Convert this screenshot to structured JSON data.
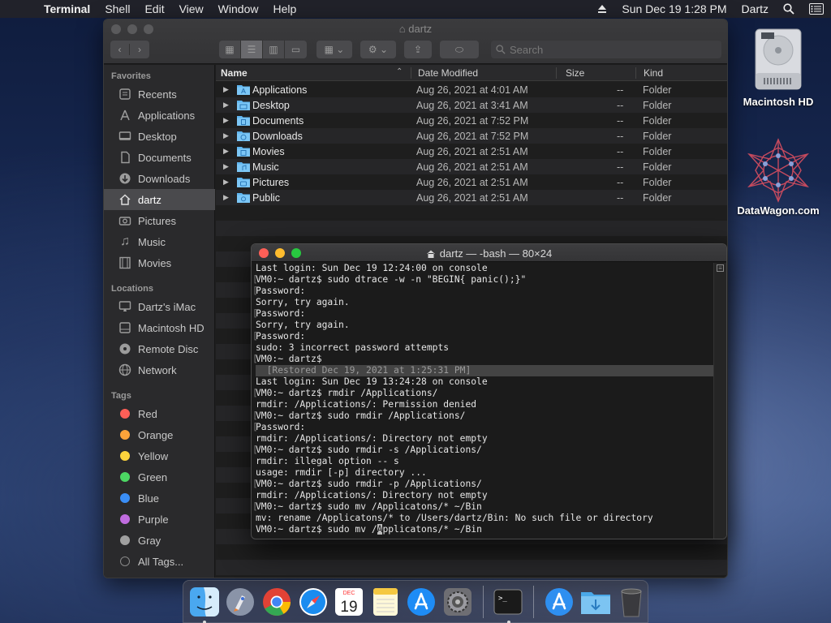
{
  "menubar": {
    "app_name": "Terminal",
    "menus": [
      "Shell",
      "Edit",
      "View",
      "Window",
      "Help"
    ],
    "datetime": "Sun Dec 19  1:28 PM",
    "user": "Dartz"
  },
  "finder": {
    "title": "dartz",
    "search_placeholder": "Search",
    "sidebar": {
      "favorites_label": "Favorites",
      "favorites": [
        "Recents",
        "Applications",
        "Desktop",
        "Documents",
        "Downloads",
        "dartz",
        "Pictures",
        "Music",
        "Movies"
      ],
      "locations_label": "Locations",
      "locations": [
        "Dartz's iMac",
        "Macintosh HD",
        "Remote Disc",
        "Network"
      ],
      "tags_label": "Tags",
      "tags": [
        {
          "label": "Red",
          "color": "#fe5f57"
        },
        {
          "label": "Orange",
          "color": "#fda33a"
        },
        {
          "label": "Yellow",
          "color": "#fdd33d"
        },
        {
          "label": "Green",
          "color": "#4cd763"
        },
        {
          "label": "Blue",
          "color": "#3a8ef6"
        },
        {
          "label": "Purple",
          "color": "#c06cdf"
        },
        {
          "label": "Gray",
          "color": "#a0a0a0"
        },
        {
          "label": "All Tags...",
          "color": ""
        }
      ]
    },
    "columns": {
      "name": "Name",
      "date": "Date Modified",
      "size": "Size",
      "kind": "Kind"
    },
    "files": [
      {
        "name": "Applications",
        "date": "Aug 26, 2021 at 4:01 AM",
        "size": "--",
        "kind": "Folder"
      },
      {
        "name": "Desktop",
        "date": "Aug 26, 2021 at 3:41 AM",
        "size": "--",
        "kind": "Folder"
      },
      {
        "name": "Documents",
        "date": "Aug 26, 2021 at 7:52 PM",
        "size": "--",
        "kind": "Folder"
      },
      {
        "name": "Downloads",
        "date": "Aug 26, 2021 at 7:52 PM",
        "size": "--",
        "kind": "Folder"
      },
      {
        "name": "Movies",
        "date": "Aug 26, 2021 at 2:51 AM",
        "size": "--",
        "kind": "Folder"
      },
      {
        "name": "Music",
        "date": "Aug 26, 2021 at 2:51 AM",
        "size": "--",
        "kind": "Folder"
      },
      {
        "name": "Pictures",
        "date": "Aug 26, 2021 at 2:51 AM",
        "size": "--",
        "kind": "Folder"
      },
      {
        "name": "Public",
        "date": "Aug 26, 2021 at 2:51 AM",
        "size": "--",
        "kind": "Folder"
      }
    ]
  },
  "terminal": {
    "title": "dartz — -bash — 80×24",
    "lines": [
      {
        "text": "Last login: Sun Dec 19 12:24:00 on console",
        "mark": false
      },
      {
        "text": "VM0:~ dartz$ sudo dtrace -w -n \"BEGIN{ panic();}\"",
        "mark": true
      },
      {
        "text": "Password:",
        "mark": true
      },
      {
        "text": "Sorry, try again.",
        "mark": false
      },
      {
        "text": "Password:",
        "mark": true
      },
      {
        "text": "Sorry, try again.",
        "mark": false
      },
      {
        "text": "Password:",
        "mark": true
      },
      {
        "text": "sudo: 3 incorrect password attempts",
        "mark": false
      },
      {
        "text": "VM0:~ dartz$ ",
        "mark": true
      },
      {
        "text": "  [Restored Dec 19, 2021 at 1:25:31 PM]",
        "mark": false,
        "restored": true
      },
      {
        "text": "Last login: Sun Dec 19 13:24:28 on console",
        "mark": false
      },
      {
        "text": "VM0:~ dartz$ rmdir /Applications/",
        "mark": true
      },
      {
        "text": "rmdir: /Applications/: Permission denied",
        "mark": false
      },
      {
        "text": "VM0:~ dartz$ sudo rmdir /Applications/",
        "mark": true
      },
      {
        "text": "Password:",
        "mark": true
      },
      {
        "text": "rmdir: /Applications/: Directory not empty",
        "mark": false
      },
      {
        "text": "VM0:~ dartz$ sudo rmdir -s /Applications/",
        "mark": true
      },
      {
        "text": "rmdir: illegal option -- s",
        "mark": false
      },
      {
        "text": "usage: rmdir [-p] directory ...",
        "mark": false
      },
      {
        "text": "VM0:~ dartz$ sudo rmdir -p /Applications/",
        "mark": true
      },
      {
        "text": "rmdir: /Applications/: Directory not empty",
        "mark": false
      },
      {
        "text": "VM0:~ dartz$ sudo mv /Applicatons/* ~/Bin",
        "mark": true
      },
      {
        "text": "mv: rename /Applicatons/* to /Users/dartz/Bin: No such file or directory",
        "mark": false
      }
    ],
    "prompt_before_cursor": "VM0:~ dartz$ sudo mv /",
    "cursor_char": "A",
    "prompt_after_cursor": "pplicatons/* ~/Bin"
  },
  "desktop": {
    "icons": [
      {
        "label": "Macintosh HD",
        "icon": "hard-drive-icon"
      },
      {
        "label": "DataWagon.com",
        "icon": "network-drive-icon"
      }
    ]
  },
  "dock": {
    "apps": [
      "finder-icon",
      "launchpad-icon",
      "chrome-icon",
      "safari-icon",
      "calendar-icon",
      "notes-icon",
      "app-store-icon",
      "system-preferences-icon",
      "terminal-icon",
      "applications-folder-icon",
      "downloads-folder-icon",
      "trash-icon"
    ],
    "calendar_month": "DEC",
    "calendar_day": "19"
  }
}
